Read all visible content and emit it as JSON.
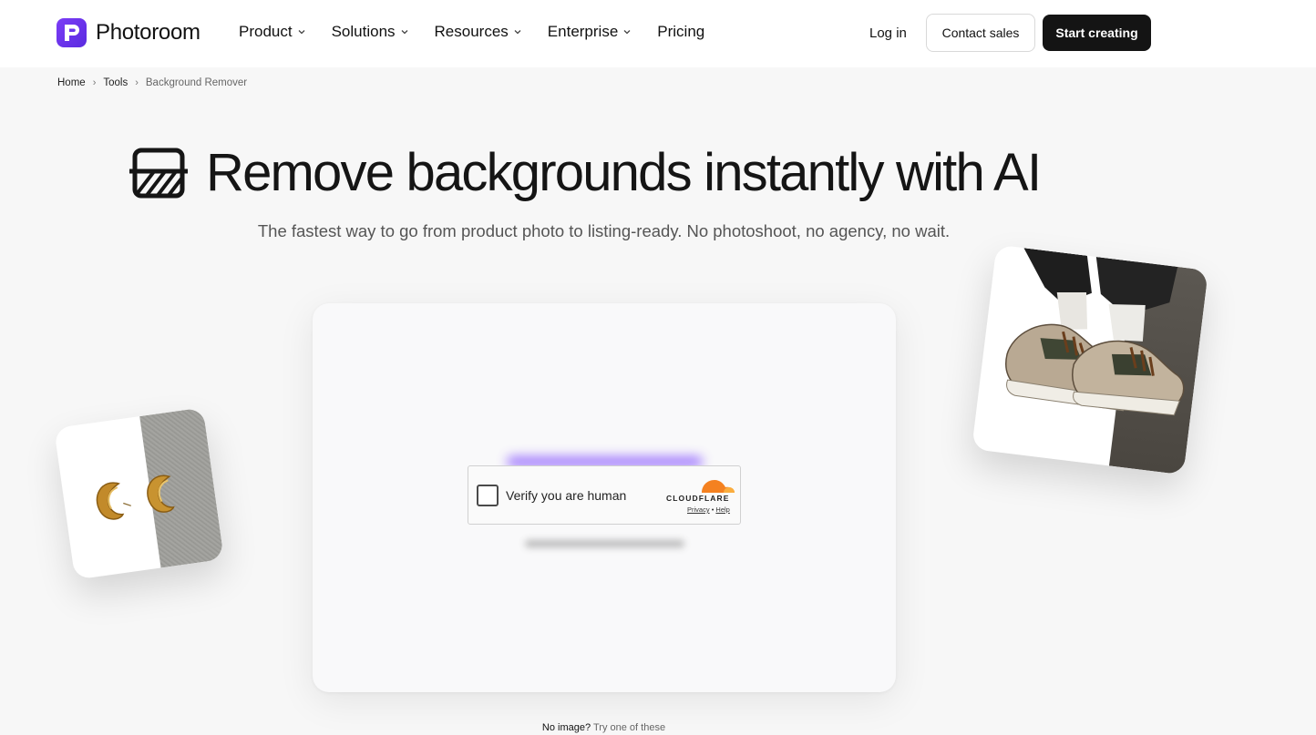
{
  "nav": {
    "brand": "Photoroom",
    "menu": [
      {
        "label": "Product",
        "has_dropdown": true
      },
      {
        "label": "Solutions",
        "has_dropdown": true
      },
      {
        "label": "Resources",
        "has_dropdown": true
      },
      {
        "label": "Enterprise",
        "has_dropdown": true
      },
      {
        "label": "Pricing",
        "has_dropdown": false
      }
    ],
    "login": "Log in",
    "contact_sales": "Contact sales",
    "start_creating": "Start creating"
  },
  "breadcrumb": [
    "Home",
    "Tools",
    "Background Remover"
  ],
  "hero": {
    "title": "Remove backgrounds instantly with AI",
    "subtitle": "The fastest way to go from product photo to listing-ready. No photoshoot, no agency, no wait."
  },
  "captcha": {
    "label": "Verify you are human",
    "provider": "CLOUDFLARE",
    "privacy": "Privacy",
    "separator": "•",
    "help": "Help"
  },
  "samples": {
    "no_image": "No image?",
    "try": "Try one of these"
  },
  "colors": {
    "brand": "#6a34f0",
    "primary_button": "#141414",
    "cloudflare_orange": "#f48120"
  }
}
